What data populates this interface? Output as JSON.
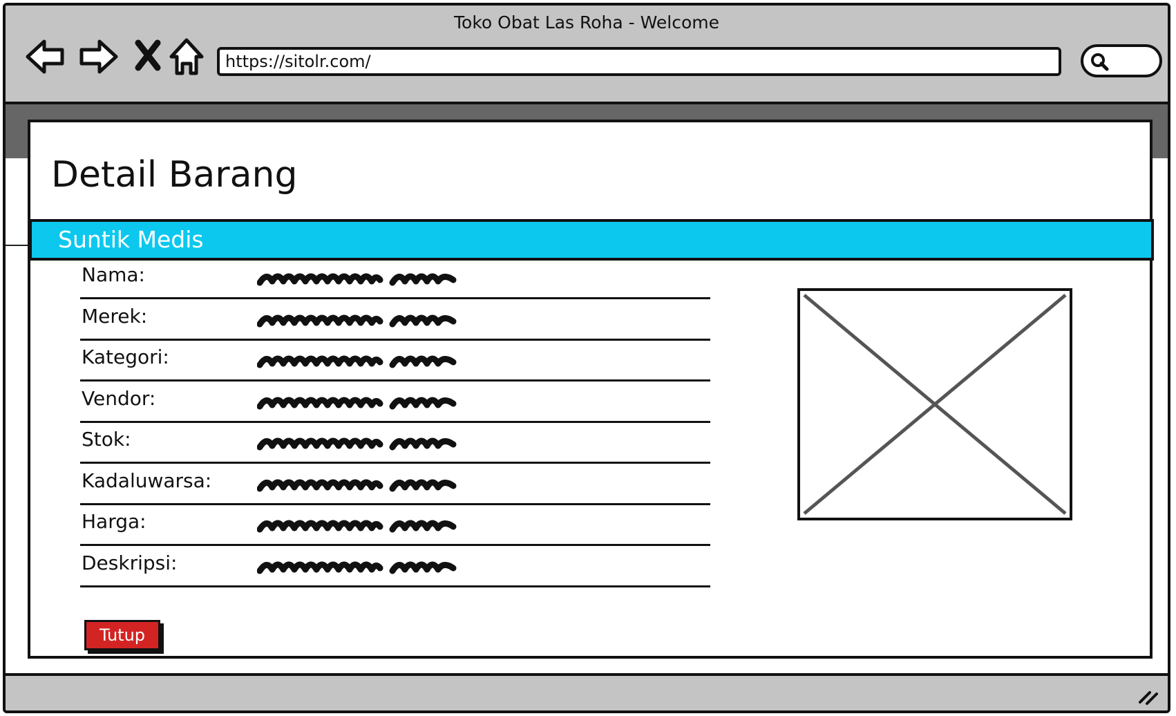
{
  "window": {
    "title": "Toko Obat Las Roha - Welcome",
    "url": "https://sitolr.com/"
  },
  "icons": [
    "back-arrow-icon",
    "forward-arrow-icon",
    "close-x-icon",
    "home-icon",
    "search-icon",
    "resize-grip-icon",
    "image-placeholder-icon"
  ],
  "modal": {
    "title": "Detail Barang",
    "header": "Suntik Medis",
    "header_color": "#0cc8ee",
    "fields": [
      {
        "label": "Nama:"
      },
      {
        "label": "Merek:"
      },
      {
        "label": "Kategori:"
      },
      {
        "label": "Vendor:"
      },
      {
        "label": "Stok:"
      },
      {
        "label": "Kadaluwarsa:"
      },
      {
        "label": "Harga:"
      },
      {
        "label": "Deskripsi:"
      }
    ],
    "close_button": "Tutup",
    "close_button_color": "#d32424"
  }
}
